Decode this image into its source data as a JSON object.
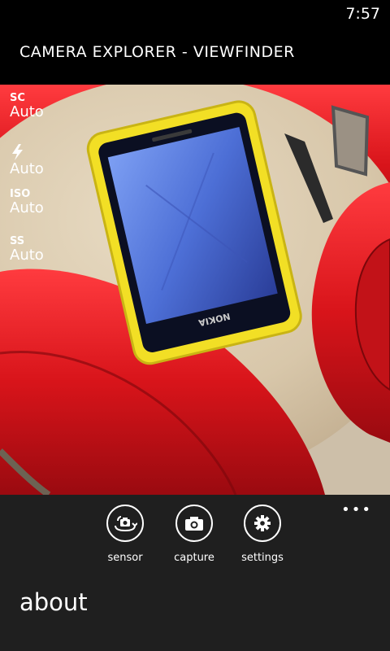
{
  "status": {
    "time": "7:57"
  },
  "app": {
    "title": "CAMERA EXPLORER - VIEWFINDER"
  },
  "viewfinder": {
    "params": [
      {
        "label": "SC",
        "value": "Auto",
        "icon": null
      },
      {
        "label": "",
        "value": "Auto",
        "icon": "flash-icon"
      },
      {
        "label": "ISO",
        "value": "Auto",
        "icon": null
      },
      {
        "label": "SS",
        "value": "Auto",
        "icon": null
      }
    ],
    "phone_brand_text": "NOKIA"
  },
  "appbar": {
    "more_glyph": "•••",
    "buttons": [
      {
        "label": "sensor",
        "icon": "switch-camera-icon"
      },
      {
        "label": "capture",
        "icon": "camera-icon"
      },
      {
        "label": "settings",
        "icon": "gear-icon"
      }
    ],
    "menu_items": [
      {
        "label": "about"
      }
    ]
  },
  "colors": {
    "headphone_red": "#d8141a",
    "phone_yellow": "#f2df25",
    "table_wood": "#d9c8ac"
  }
}
